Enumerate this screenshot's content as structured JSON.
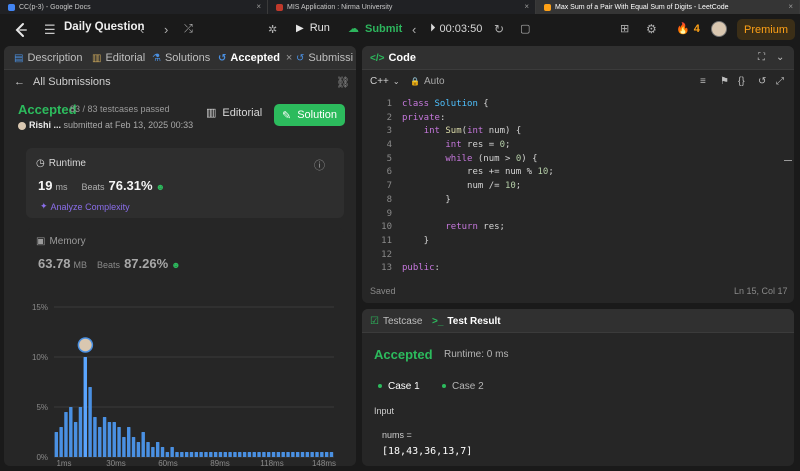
{
  "browser_tabs": [
    {
      "title": "CC(p-3) - Google Docs",
      "favicon_color": "#4285f4",
      "active": false
    },
    {
      "title": "MIS Application : Nirma University",
      "favicon_color": "#c0392b",
      "active": false
    },
    {
      "title": "Max Sum of a Pair With Equal Sum of Digits - LeetCode",
      "favicon_color": "#ffa116",
      "active": true
    }
  ],
  "nav": {
    "title": "Daily Question",
    "run_label": "Run",
    "submit_label": "Submit",
    "timer": "00:03:50",
    "streak": "4",
    "premium_label": "Premium"
  },
  "left_tabs": [
    {
      "label": "Description",
      "icon": "file-icon"
    },
    {
      "label": "Editorial",
      "icon": "book-icon"
    },
    {
      "label": "Solutions",
      "icon": "flask-icon"
    },
    {
      "label": "Accepted",
      "icon": "history-icon"
    },
    {
      "label": "Submissi",
      "icon": "history-icon"
    }
  ],
  "submission": {
    "back_label": "All Submissions",
    "status": "Accepted",
    "testcases": "83 / 83 testcases passed",
    "user": "Rishi ...",
    "submitted_at": "submitted at Feb 13, 2025 00:33",
    "editorial_label": "Editorial",
    "solution_label": "Solution"
  },
  "runtime": {
    "label": "Runtime",
    "value": "19",
    "unit": "ms",
    "beats_label": "Beats",
    "beats": "76.31%",
    "analyze_label": "Analyze Complexity"
  },
  "memory": {
    "label": "Memory",
    "value": "63.78",
    "unit": "MB",
    "beats_label": "Beats",
    "beats": "87.26%"
  },
  "chart_data": {
    "type": "bar",
    "y_ticks": [
      "15%",
      "10%",
      "5%",
      "0%"
    ],
    "ylim": [
      0,
      15
    ],
    "x_ticks": [
      "1ms",
      "30ms",
      "60ms",
      "89ms",
      "118ms",
      "148ms"
    ],
    "values": [
      2.5,
      3,
      4.5,
      5,
      3.5,
      5,
      10,
      7,
      4,
      3,
      4,
      3.5,
      3.5,
      3,
      2,
      3,
      2,
      1.5,
      2.5,
      1.5,
      1,
      1.5,
      1,
      0.5,
      1,
      0.5,
      0.5,
      0.5,
      0.5,
      0.5,
      0.5,
      0.5,
      0.5,
      0.5,
      0.5,
      0.5,
      0.5,
      0.5,
      0.5,
      0.5,
      0.5,
      0.5,
      0.5,
      0.5,
      0.5,
      0.5,
      0.5,
      0.5,
      0.5,
      0.5,
      0.5,
      0.5,
      0.5,
      0.5,
      0.5,
      0.5,
      0.5,
      0.5
    ],
    "highlight_index": 6,
    "bar_color": "#4a90e2",
    "highlight_color": "#5aa5ff"
  },
  "code_panel": {
    "title": "Code",
    "language": "C++",
    "mode": "Auto",
    "lines": [
      [
        [
          "k",
          "class"
        ],
        [
          "p",
          " "
        ],
        [
          "t",
          "Solution"
        ],
        [
          "p",
          " {"
        ]
      ],
      [
        [
          "k",
          "private"
        ],
        [
          "p",
          ":"
        ]
      ],
      [
        [
          "p",
          "    "
        ],
        [
          "k",
          "int"
        ],
        [
          "p",
          " "
        ],
        [
          "f",
          "Sum"
        ],
        [
          "p",
          "("
        ],
        [
          "k",
          "int"
        ],
        [
          "p",
          " num) {"
        ]
      ],
      [
        [
          "p",
          "        "
        ],
        [
          "k",
          "int"
        ],
        [
          "p",
          " res = "
        ],
        [
          "n",
          "0"
        ],
        [
          "p",
          ";"
        ]
      ],
      [
        [
          "p",
          "        "
        ],
        [
          "k",
          "while"
        ],
        [
          "p",
          " (num > "
        ],
        [
          "n",
          "0"
        ],
        [
          "p",
          ") {"
        ]
      ],
      [
        [
          "p",
          "            res += num % "
        ],
        [
          "n",
          "10"
        ],
        [
          "p",
          ";"
        ]
      ],
      [
        [
          "p",
          "            num /= "
        ],
        [
          "n",
          "10"
        ],
        [
          "p",
          ";"
        ]
      ],
      [
        [
          "p",
          "        }"
        ]
      ],
      [
        [
          "p",
          ""
        ]
      ],
      [
        [
          "p",
          "        "
        ],
        [
          "k",
          "return"
        ],
        [
          "p",
          " res;"
        ]
      ],
      [
        [
          "p",
          "    }"
        ]
      ],
      [
        [
          "p",
          ""
        ]
      ],
      [
        [
          "k",
          "public"
        ],
        [
          "p",
          ":"
        ]
      ]
    ],
    "saved_label": "Saved",
    "cursor": "Ln 15, Col 17"
  },
  "test_panel": {
    "testcase_tab": "Testcase",
    "result_tab": "Test Result",
    "status": "Accepted",
    "runtime": "Runtime: 0 ms",
    "case1": "Case 1",
    "case2": "Case 2",
    "input_label": "Input",
    "var_label": "nums =",
    "var_value": "[18,43,36,13,7]"
  }
}
